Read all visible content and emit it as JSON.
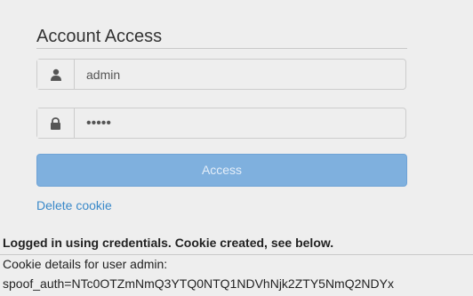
{
  "form": {
    "title": "Account Access",
    "username": {
      "value": "admin",
      "icon": "user-icon"
    },
    "password": {
      "value": "•••••",
      "icon": "lock-icon"
    },
    "submit_label": "Access",
    "delete_cookie_label": "Delete cookie"
  },
  "result": {
    "status_message": "Logged in using credentials. Cookie created, see below.",
    "details_label": "Cookie details for user admin:",
    "cookie_value": "spoof_auth=NTc0OTZmNmQ3YTQ0NTQ1NDVhNjk2ZTY5NmQ2NDYx"
  },
  "colors": {
    "background": "#eeeeee",
    "button": "#7fb0de",
    "link": "#3a89c9"
  }
}
